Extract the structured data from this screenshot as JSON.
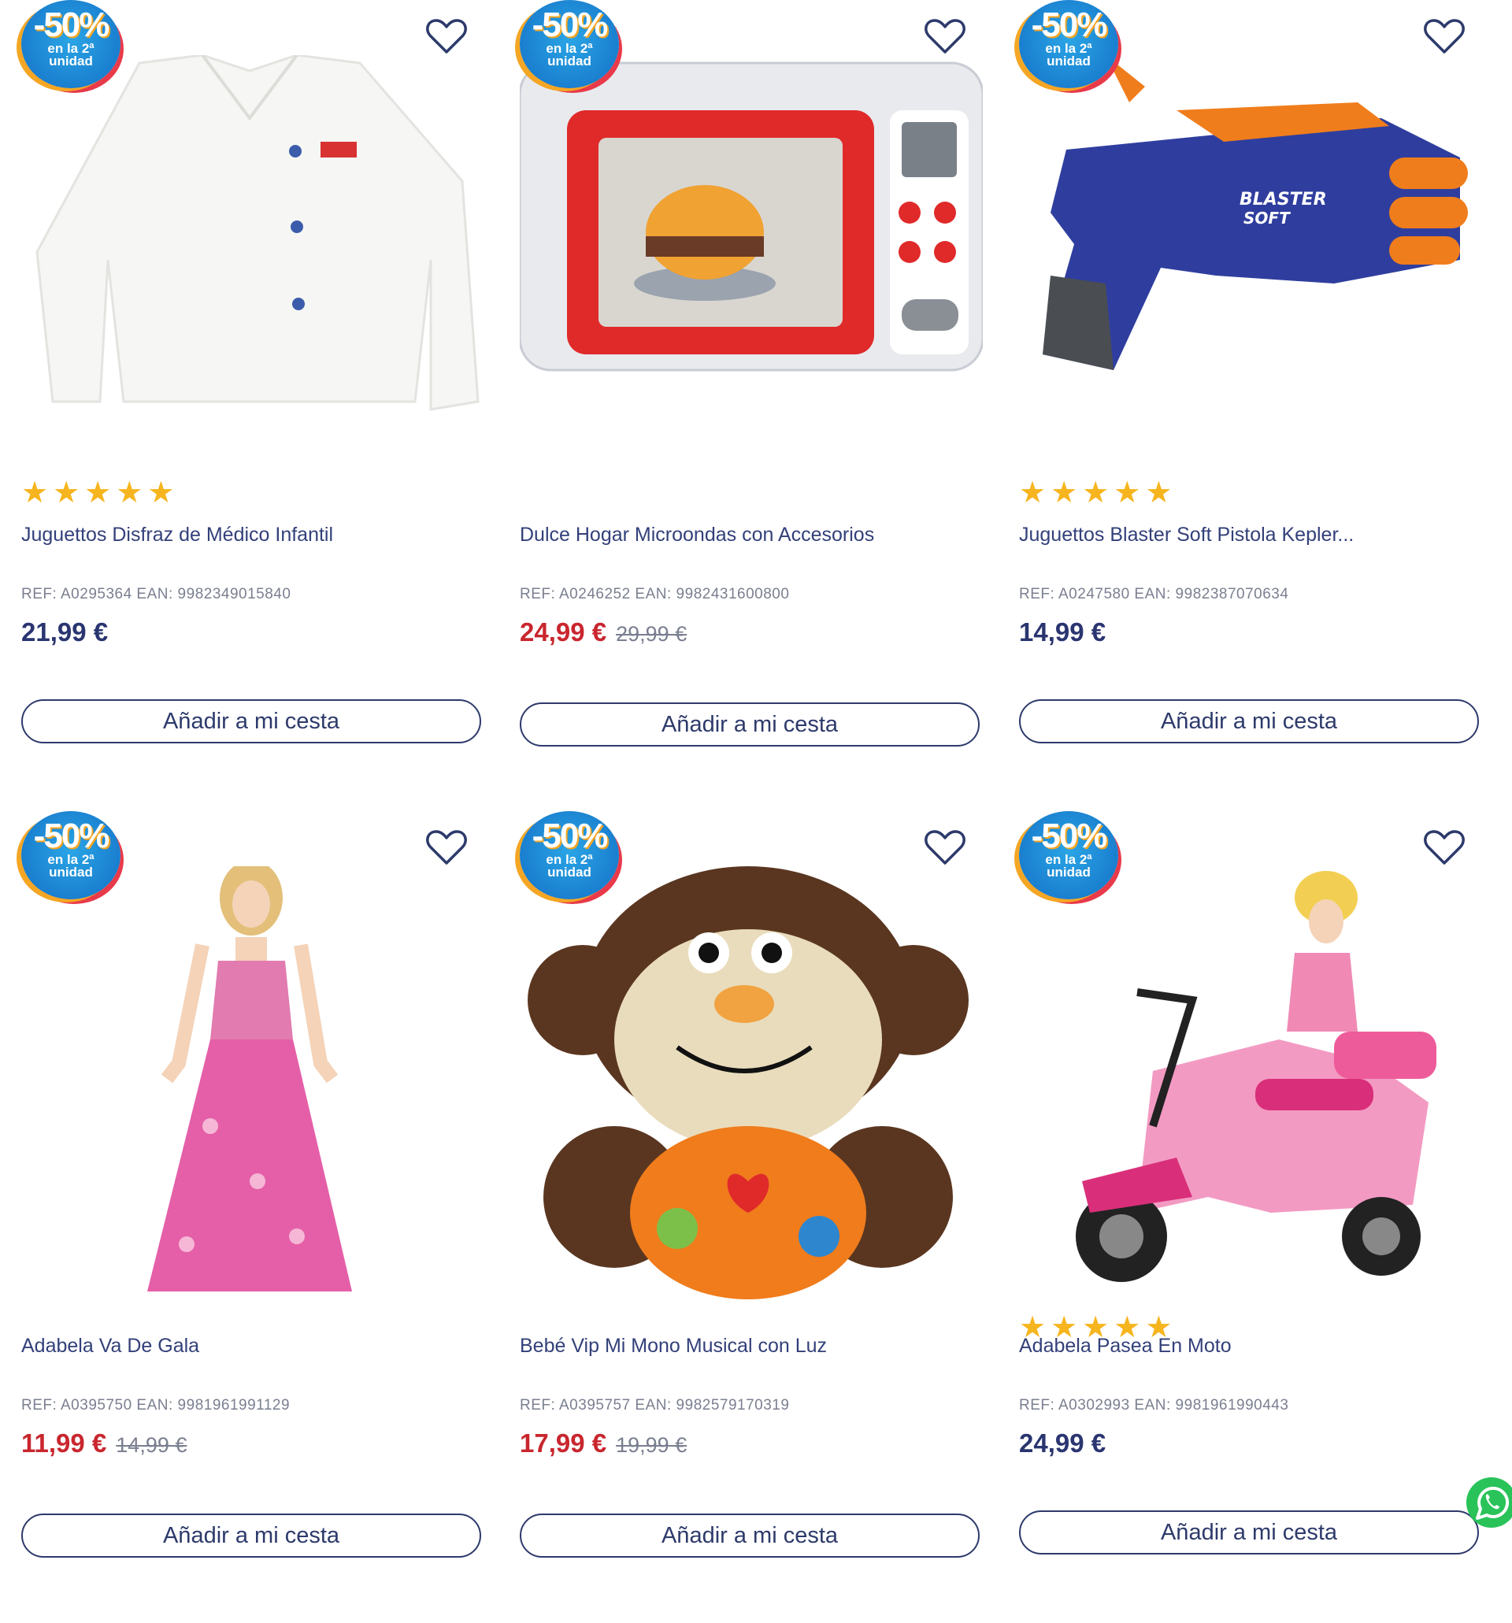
{
  "promo_badge": {
    "percent": "-50%",
    "line1": "en la 2ª",
    "line2": "unidad"
  },
  "add_to_cart_label": "Añadir a mi cesta",
  "colors": {
    "accent": "#2d3a6b",
    "sale_price": "#c9262e",
    "star": "#f6b51e",
    "whatsapp": "#29c359"
  },
  "products": [
    {
      "name": "Juguettos Disfraz de Médico Infantil",
      "ref": "REF: A0295364 EAN: 9982349015840",
      "price": "21,99 €",
      "old_price": "",
      "on_sale": false,
      "rating_stars": 5,
      "image_icon": "doctor-coat"
    },
    {
      "name": "Dulce Hogar Microondas con Accesorios",
      "ref": "REF: A0246252 EAN: 9982431600800",
      "price": "24,99 €",
      "old_price": "29,99 €",
      "on_sale": true,
      "rating_stars": 0,
      "image_icon": "toy-microwave"
    },
    {
      "name": "Juguettos Blaster Soft Pistola Kepler...",
      "ref": "REF: A0247580 EAN: 9982387070634",
      "price": "14,99 €",
      "old_price": "",
      "on_sale": false,
      "rating_stars": 5,
      "image_icon": "blaster-gun"
    },
    {
      "name": "Adabela Va De Gala",
      "ref": "REF: A0395750 EAN: 9981961991129",
      "price": "11,99 €",
      "old_price": "14,99 €",
      "on_sale": true,
      "rating_stars": 0,
      "image_icon": "doll-gown"
    },
    {
      "name": "Bebé Vip Mi Mono Musical con Luz",
      "ref": "REF: A0395757 EAN: 9982579170319",
      "price": "17,99 €",
      "old_price": "19,99 €",
      "on_sale": true,
      "rating_stars": 0,
      "image_icon": "plush-monkey"
    },
    {
      "name": "Adabela Pasea En Moto",
      "ref": "REF: A0302993 EAN: 9981961990443",
      "price": "24,99 €",
      "old_price": "",
      "on_sale": false,
      "rating_stars": 5,
      "image_icon": "doll-scooter"
    }
  ]
}
